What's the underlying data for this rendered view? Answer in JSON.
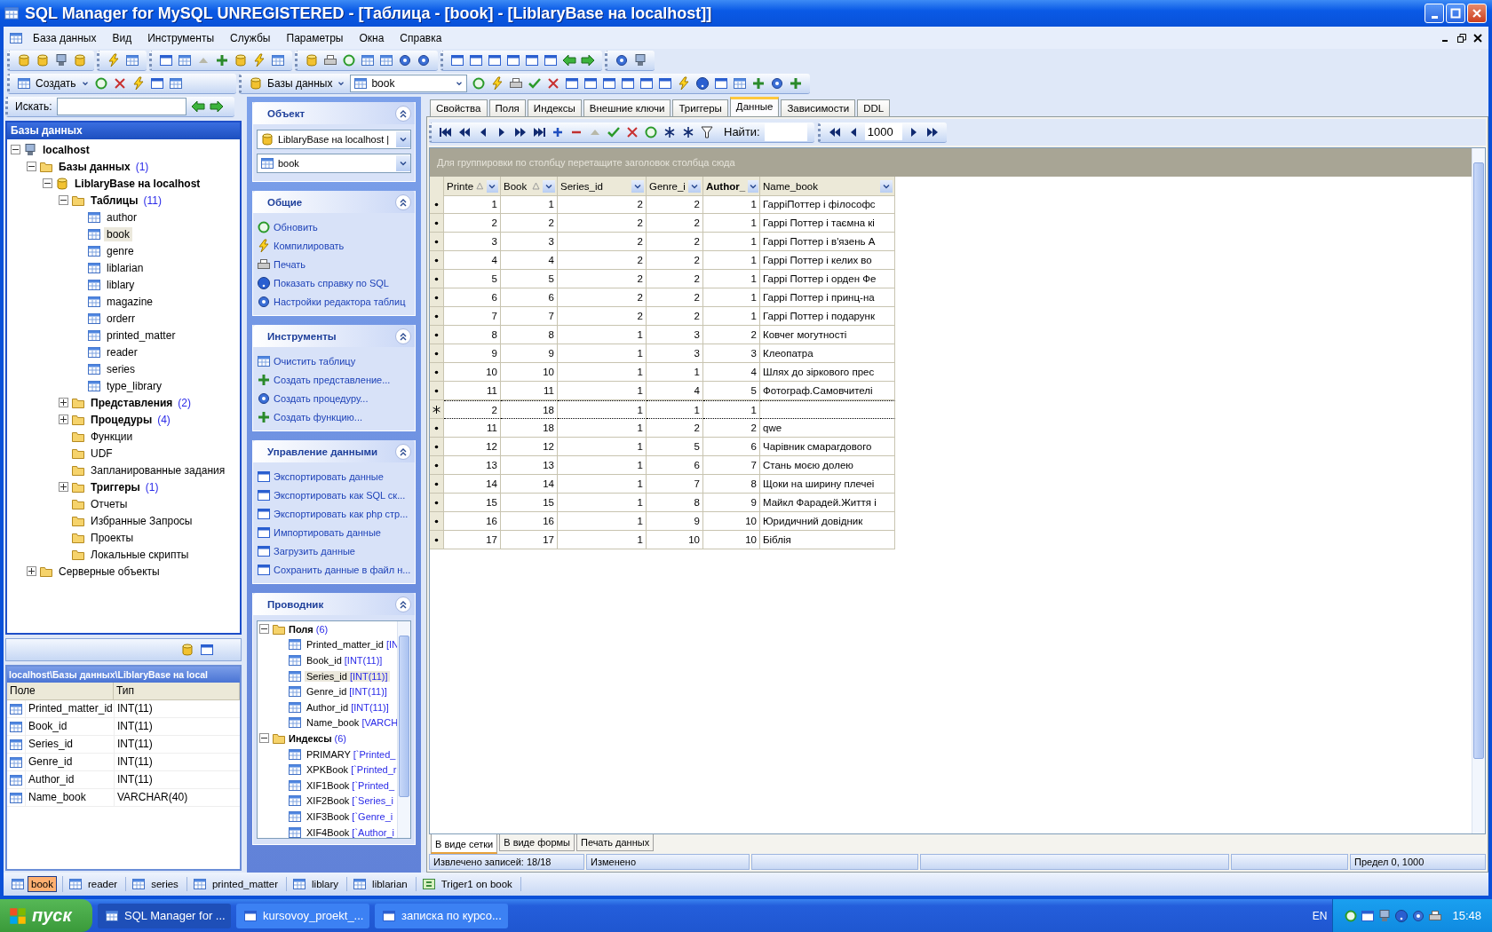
{
  "window": {
    "title": "SQL Manager for MySQL UNREGISTERED - [Таблица - [book] - [LiblaryBase на localhost]]"
  },
  "menu": [
    "База данных",
    "Вид",
    "Инструменты",
    "Службы",
    "Параметры",
    "Окна",
    "Справка"
  ],
  "toolbar": {
    "create": "Создать",
    "databases": "Базы данных",
    "object": "book"
  },
  "search": {
    "label": "Искать:"
  },
  "explorer": {
    "title": "Базы данных",
    "tree": [
      {
        "label": "localhost",
        "kind": "server",
        "bold": true,
        "expanded": true,
        "selected": false,
        "children": [
          {
            "label": "Базы данных",
            "count": "(1)",
            "kind": "folder",
            "bold": true,
            "expanded": true,
            "selected": false,
            "children": [
              {
                "label": "LiblaryBase на localhost",
                "kind": "database",
                "bold": true,
                "expanded": true,
                "selected": false,
                "children": [
                  {
                    "label": "Таблицы",
                    "count": "(11)",
                    "kind": "folder",
                    "bold": true,
                    "expanded": true,
                    "selected": false,
                    "children": [
                      {
                        "label": "author",
                        "kind": "table",
                        "bold": false,
                        "selected": false
                      },
                      {
                        "label": "book",
                        "kind": "table",
                        "bold": false,
                        "selected": true
                      },
                      {
                        "label": "genre",
                        "kind": "table",
                        "bold": false,
                        "selected": false
                      },
                      {
                        "label": "liblarian",
                        "kind": "table",
                        "bold": false,
                        "selected": false
                      },
                      {
                        "label": "liblary",
                        "kind": "table",
                        "bold": false,
                        "selected": false
                      },
                      {
                        "label": "magazine",
                        "kind": "table",
                        "bold": false,
                        "selected": false
                      },
                      {
                        "label": "orderr",
                        "kind": "table",
                        "bold": false,
                        "selected": false
                      },
                      {
                        "label": "printed_matter",
                        "kind": "table",
                        "bold": false,
                        "selected": false
                      },
                      {
                        "label": "reader",
                        "kind": "table",
                        "bold": false,
                        "selected": false
                      },
                      {
                        "label": "series",
                        "kind": "table",
                        "bold": false,
                        "selected": false
                      },
                      {
                        "label": "type_library",
                        "kind": "table",
                        "bold": false,
                        "selected": false
                      }
                    ]
                  },
                  {
                    "label": "Представления",
                    "count": "(2)",
                    "kind": "folder",
                    "bold": true,
                    "expanded": false,
                    "selected": false
                  },
                  {
                    "label": "Процедуры",
                    "count": "(4)",
                    "kind": "folder",
                    "bold": true,
                    "expanded": false,
                    "selected": false
                  },
                  {
                    "label": "Функции",
                    "kind": "folder",
                    "bold": false,
                    "selected": false
                  },
                  {
                    "label": "UDF",
                    "kind": "folder",
                    "bold": false,
                    "selected": false
                  },
                  {
                    "label": "Запланированные задания",
                    "kind": "folder",
                    "bold": false,
                    "selected": false
                  },
                  {
                    "label": "Триггеры",
                    "count": "(1)",
                    "kind": "folder",
                    "bold": true,
                    "expanded": false,
                    "selected": false
                  },
                  {
                    "label": "Отчеты",
                    "kind": "folder",
                    "bold": false,
                    "selected": false
                  },
                  {
                    "label": "Избранные Запросы",
                    "kind": "folder",
                    "bold": false,
                    "selected": false
                  },
                  {
                    "label": "Проекты",
                    "kind": "folder",
                    "bold": false,
                    "selected": false
                  },
                  {
                    "label": "Локальные скрипты",
                    "kind": "folder",
                    "bold": false,
                    "selected": false
                  }
                ]
              }
            ]
          },
          {
            "label": "Серверные объекты",
            "kind": "folder",
            "bold": false,
            "expanded": false,
            "selected": false
          }
        ]
      }
    ]
  },
  "fields_panel": {
    "path": "localhost\\Базы данных\\LiblaryBase на local",
    "columns": [
      "Поле",
      "Тип"
    ],
    "rows": [
      [
        "Printed_matter_id",
        "INT(11)"
      ],
      [
        "Book_id",
        "INT(11)"
      ],
      [
        "Series_id",
        "INT(11)"
      ],
      [
        "Genre_id",
        "INT(11)"
      ],
      [
        "Author_id",
        "INT(11)"
      ],
      [
        "Name_book",
        "VARCHAR(40)"
      ]
    ]
  },
  "nav_sections": [
    {
      "title": "Объект",
      "kind": "selects",
      "expanded": true,
      "selects": [
        "LiblaryBase на localhost |",
        "book"
      ]
    },
    {
      "title": "Общие",
      "kind": "links",
      "expanded": true,
      "links": [
        {
          "label": "Обновить"
        },
        {
          "label": "Компилировать"
        },
        {
          "label": "Печать"
        },
        {
          "label": "Показать справку по  SQL"
        },
        {
          "label": "Настройки редактора таблиц"
        }
      ]
    },
    {
      "title": "Инструменты",
      "kind": "links",
      "expanded": true,
      "links": [
        {
          "label": "Очистить таблицу"
        },
        {
          "label": "Создать представление..."
        },
        {
          "label": "Создать процедуру..."
        },
        {
          "label": "Создать функцию..."
        }
      ]
    },
    {
      "title": "Управление данными",
      "kind": "links",
      "expanded": true,
      "links": [
        {
          "label": "Экспортировать данные"
        },
        {
          "label": "Экспортировать как SQL ск..."
        },
        {
          "label": "Экспортировать как php стр..."
        },
        {
          "label": "Импортировать данные"
        },
        {
          "label": "Загрузить данные"
        },
        {
          "label": "Сохранить данные в файл н..."
        }
      ]
    },
    {
      "title": "Проводник",
      "kind": "tree",
      "expanded": true,
      "tree": [
        {
          "label": "Поля",
          "count": "(6)",
          "expanded": true,
          "children": [
            {
              "label": "Printed_matter_id",
              "detail": "[IN",
              "selected": false
            },
            {
              "label": "Book_id",
              "detail": "[INT(11)]",
              "selected": false
            },
            {
              "label": "Series_id",
              "detail": "[INT(11)]",
              "selected": true
            },
            {
              "label": "Genre_id",
              "detail": "[INT(11)]",
              "selected": false
            },
            {
              "label": "Author_id",
              "detail": "[INT(11)]",
              "selected": false
            },
            {
              "label": "Name_book",
              "detail": "[VARCH",
              "selected": false
            }
          ]
        },
        {
          "label": "Индексы",
          "count": "(6)",
          "expanded": true,
          "children": [
            {
              "label": "PRIMARY",
              "detail": "[`Printed_",
              "selected": false
            },
            {
              "label": "XPKBook",
              "detail": "[`Printed_r",
              "selected": false
            },
            {
              "label": "XIF1Book",
              "detail": "[`Printed_",
              "selected": false
            },
            {
              "label": "XIF2Book",
              "detail": "[`Series_i",
              "selected": false
            },
            {
              "label": "XIF3Book",
              "detail": "[`Genre_i",
              "selected": false
            },
            {
              "label": "XIF4Book",
              "detail": "[`Author_i",
              "selected": false
            }
          ]
        }
      ]
    }
  ],
  "tabs": [
    {
      "label": "Свойства",
      "selected": false
    },
    {
      "label": "Поля",
      "selected": false
    },
    {
      "label": "Индексы",
      "selected": false
    },
    {
      "label": "Внешние ключи",
      "selected": false
    },
    {
      "label": "Триггеры",
      "selected": false
    },
    {
      "label": "Данные",
      "selected": true
    },
    {
      "label": "Зависимости",
      "selected": false
    },
    {
      "label": "DDL",
      "selected": false
    }
  ],
  "data_nav": {
    "find_label": "Найти:",
    "limit": "1000"
  },
  "grid": {
    "group_hint": "Для группировки по столбцу перетащите заголовок столбца сюда",
    "columns": [
      {
        "label": "Printe",
        "kind": "number",
        "sorted": true,
        "focused": false
      },
      {
        "label": "Book",
        "kind": "number",
        "sorted": true,
        "focused": false
      },
      {
        "label": "Series_id",
        "kind": "number",
        "sorted": false,
        "focused": false
      },
      {
        "label": "Genre_i",
        "kind": "number",
        "sorted": false,
        "focused": false
      },
      {
        "label": "Author_",
        "kind": "number",
        "sorted": false,
        "focused": true
      },
      {
        "label": "Name_book",
        "kind": "text",
        "sorted": false,
        "focused": false
      }
    ],
    "rows": [
      {
        "editing": false,
        "cells": [
          "1",
          "1",
          "2",
          "2",
          "1",
          "ГарріПоттер і філософс"
        ]
      },
      {
        "editing": false,
        "cells": [
          "2",
          "2",
          "2",
          "2",
          "1",
          "Гаррі Поттер і таємна кі"
        ]
      },
      {
        "editing": false,
        "cells": [
          "3",
          "3",
          "2",
          "2",
          "1",
          "Гаррі Поттер і в'язень А"
        ]
      },
      {
        "editing": false,
        "cells": [
          "4",
          "4",
          "2",
          "2",
          "1",
          "Гаррі Поттер і келих во"
        ]
      },
      {
        "editing": false,
        "cells": [
          "5",
          "5",
          "2",
          "2",
          "1",
          "Гаррі Поттер і орден Фе"
        ]
      },
      {
        "editing": false,
        "cells": [
          "6",
          "6",
          "2",
          "2",
          "1",
          "Гаррі Поттер і принц-на"
        ]
      },
      {
        "editing": false,
        "cells": [
          "7",
          "7",
          "2",
          "2",
          "1",
          "Гаррі Поттер і подарунк"
        ]
      },
      {
        "editing": false,
        "cells": [
          "8",
          "8",
          "1",
          "3",
          "2",
          "Ковчег могутності"
        ]
      },
      {
        "editing": false,
        "cells": [
          "9",
          "9",
          "1",
          "3",
          "3",
          "Клеопатра"
        ]
      },
      {
        "editing": false,
        "cells": [
          "10",
          "10",
          "1",
          "1",
          "4",
          "Шлях до зіркового прес"
        ]
      },
      {
        "editing": false,
        "cells": [
          "11",
          "11",
          "1",
          "4",
          "5",
          "Фотограф.Самовчителі"
        ]
      },
      {
        "editing": true,
        "cells": [
          "2",
          "18",
          "1",
          "1",
          "1",
          ""
        ]
      },
      {
        "editing": false,
        "cells": [
          "11",
          "18",
          "1",
          "2",
          "2",
          "qwe"
        ]
      },
      {
        "editing": false,
        "cells": [
          "12",
          "12",
          "1",
          "5",
          "6",
          "Чарівник смарагдового"
        ]
      },
      {
        "editing": false,
        "cells": [
          "13",
          "13",
          "1",
          "6",
          "7",
          "Стань моєю долею"
        ]
      },
      {
        "editing": false,
        "cells": [
          "14",
          "14",
          "1",
          "7",
          "8",
          "Щоки на ширину плечеі"
        ]
      },
      {
        "editing": false,
        "cells": [
          "15",
          "15",
          "1",
          "8",
          "9",
          "Майкл Фарадей.Життя і"
        ]
      },
      {
        "editing": false,
        "cells": [
          "16",
          "16",
          "1",
          "9",
          "10",
          "Юридичний довідник"
        ]
      },
      {
        "editing": false,
        "cells": [
          "17",
          "17",
          "1",
          "10",
          "10",
          "Біблія"
        ]
      }
    ]
  },
  "view_tabs": [
    {
      "label": "В виде сетки",
      "selected": true
    },
    {
      "label": "В виде формы",
      "selected": false
    },
    {
      "label": "Печать данных",
      "selected": false
    }
  ],
  "status_bar": {
    "records": "Извлечено записей: 18/18",
    "state": "Изменено",
    "limit": "Предел 0, 1000"
  },
  "window_tabs": [
    {
      "label": "book",
      "kind": "table",
      "selected": true
    },
    {
      "label": "reader",
      "kind": "table",
      "selected": false
    },
    {
      "label": "series",
      "kind": "table",
      "selected": false
    },
    {
      "label": "printed_matter",
      "kind": "table",
      "selected": false
    },
    {
      "label": "liblary",
      "kind": "table",
      "selected": false
    },
    {
      "label": "liblarian",
      "kind": "table",
      "selected": false
    },
    {
      "label": "Triger1 on book",
      "kind": "trigger",
      "selected": false
    }
  ],
  "taskbar": {
    "start": "пуск",
    "tasks": [
      "SQL Manager for ...",
      "kursovoy_proekt_...",
      "записка по курсо..."
    ],
    "language": "EN",
    "time": "15:48"
  }
}
